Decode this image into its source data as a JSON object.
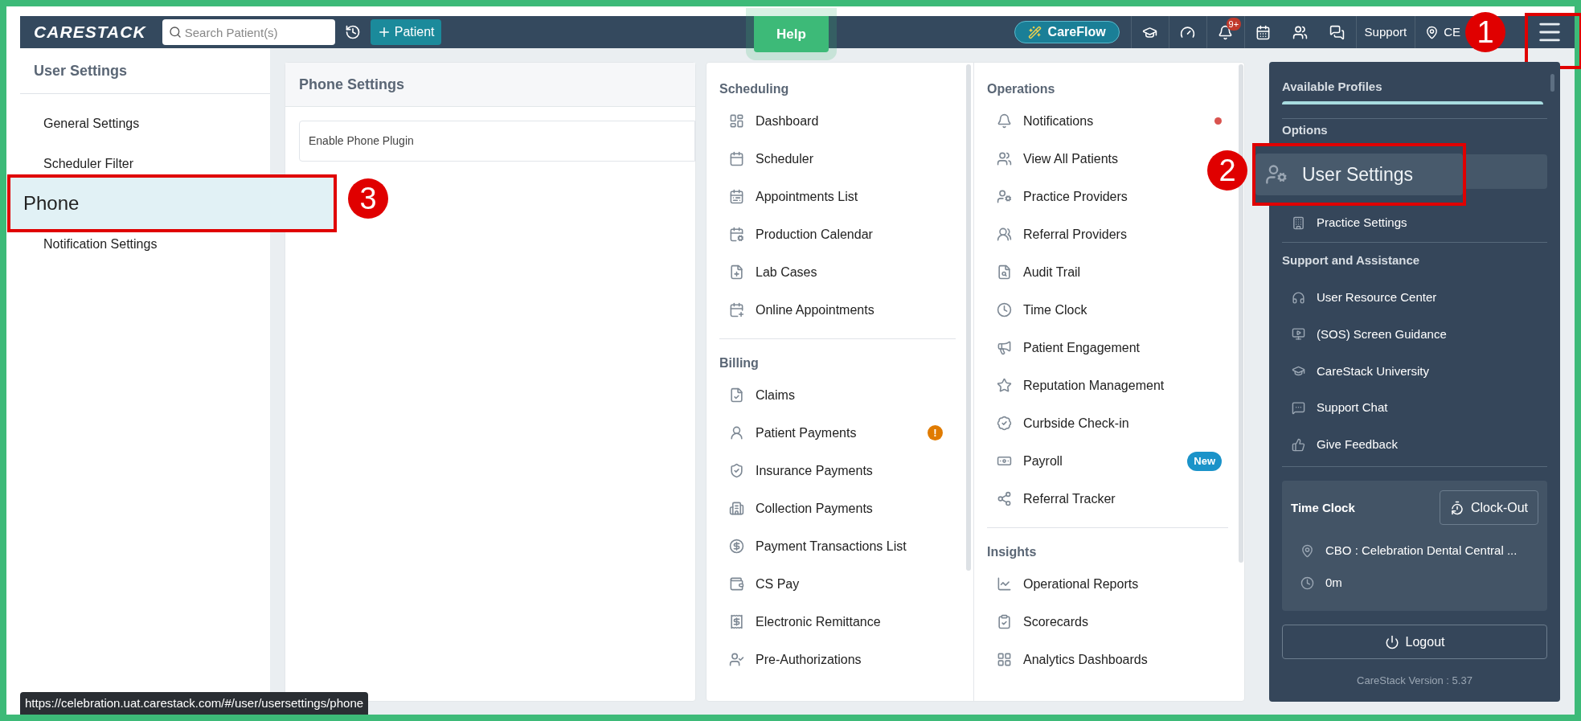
{
  "top_bar": {
    "logo": "CARESTACK",
    "search": {
      "placeholder": "Search Patient(s)"
    },
    "add_patient_button": "Patient",
    "help_button": "Help",
    "careflow_button": "CareFlow",
    "notification_badge": "9+",
    "support_link": "Support",
    "location_label": "CE"
  },
  "user_settings_sidebar": {
    "title": "User Settings",
    "items": [
      {
        "label": "General Settings",
        "selected": false
      },
      {
        "label": "Scheduler Filter",
        "selected": false
      },
      {
        "label": "Phone",
        "selected": true
      },
      {
        "label": "Notification Settings",
        "selected": false
      }
    ]
  },
  "phone_settings": {
    "title": "Phone Settings",
    "rows": [
      "Enable Phone Plugin"
    ]
  },
  "menu": {
    "columns": [
      {
        "sections": [
          {
            "title": "Scheduling",
            "items": [
              {
                "label": "Dashboard"
              },
              {
                "label": "Scheduler"
              },
              {
                "label": "Appointments List"
              },
              {
                "label": "Production Calendar"
              },
              {
                "label": "Lab Cases"
              },
              {
                "label": "Online Appointments"
              }
            ]
          },
          {
            "title": "Billing",
            "items": [
              {
                "label": "Claims"
              },
              {
                "label": "Patient Payments",
                "badge": {
                  "kind": "alert",
                  "text": "!"
                }
              },
              {
                "label": "Insurance Payments"
              },
              {
                "label": "Collection Payments"
              },
              {
                "label": "Payment Transactions List"
              },
              {
                "label": "CS Pay"
              },
              {
                "label": "Electronic Remittance"
              },
              {
                "label": "Pre-Authorizations"
              }
            ]
          }
        ]
      },
      {
        "sections": [
          {
            "title": "Operations",
            "items": [
              {
                "label": "Notifications",
                "badge": {
                  "kind": "dot"
                }
              },
              {
                "label": "View All Patients"
              },
              {
                "label": "Practice Providers"
              },
              {
                "label": "Referral Providers"
              },
              {
                "label": "Audit Trail"
              },
              {
                "label": "Time Clock"
              },
              {
                "label": "Patient Engagement"
              },
              {
                "label": "Reputation Management"
              },
              {
                "label": "Curbside Check-in"
              },
              {
                "label": "Payroll",
                "badge": {
                  "kind": "new",
                  "text": "New"
                }
              },
              {
                "label": "Referral Tracker"
              }
            ]
          },
          {
            "title": "Insights",
            "items": [
              {
                "label": "Operational Reports"
              },
              {
                "label": "Scorecards"
              },
              {
                "label": "Analytics Dashboards"
              }
            ]
          }
        ]
      }
    ]
  },
  "profile_panel": {
    "profiles_title": "Available Profiles",
    "options": {
      "title": "Options",
      "items": [
        {
          "label": "User Settings",
          "selected": true
        },
        {
          "label": "Practice Settings",
          "selected": false
        }
      ]
    },
    "support": {
      "title": "Support and Assistance",
      "items": [
        {
          "label": "User Resource Center"
        },
        {
          "label": "(SOS) Screen Guidance"
        },
        {
          "label": "CareStack University"
        },
        {
          "label": "Support Chat"
        },
        {
          "label": "Give Feedback"
        }
      ]
    },
    "time_clock": {
      "title": "Time Clock",
      "button": "Clock-Out",
      "location": "CBO : Celebration Dental Central ...",
      "duration": "0m"
    },
    "logout_button": "Logout",
    "version": "CareStack Version : 5.37"
  },
  "status_url": "https://celebration.uat.carestack.com/#/user/usersettings/phone",
  "callouts": [
    {
      "number": "1"
    },
    {
      "number": "2"
    },
    {
      "number": "3"
    }
  ]
}
